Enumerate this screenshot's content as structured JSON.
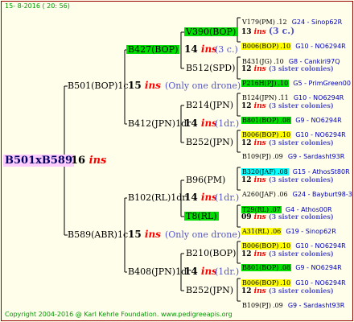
{
  "header": "15- 8-2016 ( 20: 56)",
  "footer": "Copyright 2004-2016 @ Karl Kehrle Foundation.  www.pedigreeapis.org",
  "root": {
    "label": "B501xB589",
    "gen": "16",
    "ins": "ins"
  },
  "gen2": [
    {
      "label": "B501(BOP)1c",
      "gen": "15",
      "ins": "ins",
      "note": "(Only one drone)"
    },
    {
      "label": "B589(ABR)1c",
      "gen": "15",
      "ins": "ins",
      "note": "(Only one drone)"
    }
  ],
  "gen3": [
    {
      "label": "B427(BOP)",
      "gen": "14",
      "ins": "ins",
      "note": "(3 c.)"
    },
    {
      "label": "B412(JPN)1dr",
      "gen": "14",
      "ins": "ins",
      "note": "(1dr.)"
    },
    {
      "label": "B102(RL)1dr",
      "gen": "14",
      "ins": "ins",
      "note": "(1dr.)"
    },
    {
      "label": "B408(JPN)1dr",
      "gen": "14",
      "ins": "ins",
      "note": "(1dr.)"
    }
  ],
  "gen4": [
    {
      "label": "V390(BOP)",
      "gen": "13",
      "ins": "ins",
      "note": "(3 c.)"
    },
    {
      "label": "B512(SPD)",
      "gen": "12",
      "ins": "ins",
      "note": "(3 sister colonies)"
    },
    {
      "label": "B214(JPN)",
      "gen": "12",
      "ins": "ins",
      "note": "(3 sister colonies)"
    },
    {
      "label": "B252(JPN)",
      "gen": "12",
      "ins": "ins",
      "note": "(3 sister colonies)"
    },
    {
      "label": "B96(PM)",
      "gen": "12",
      "ins": "ins",
      "note": "(3 sister colonies)"
    },
    {
      "label": "T8(RL)",
      "gen": "09",
      "ins": "ins",
      "note": "(3 sister colonies)"
    },
    {
      "label": "B210(BOP)",
      "gen": "12",
      "ins": "ins",
      "note": "(3 sister colonies)"
    },
    {
      "label": "B252(JPN)",
      "gen": "12",
      "ins": "ins",
      "note": "(3 sister colonies)"
    }
  ],
  "gen5": [
    {
      "label": "V179(PM)",
      "year": ".12",
      "code": "G24 - Sinop62R"
    },
    {
      "label": "B006(BOP)",
      "year": ".10",
      "code": "G10 - NO6294R"
    },
    {
      "label": "B431(JG)",
      "year": ".10",
      "code": "G8 - Cankiri97Q"
    },
    {
      "label": "P216H(PJ)",
      "year": ".10",
      "code": "G5 - PrimGreen00"
    },
    {
      "label": "B124(JPN)",
      "year": ".11",
      "code": "G10 - NO6294R"
    },
    {
      "label": "B801(BOP)",
      "year": ".08",
      "code": "G9 - NO6294R"
    },
    {
      "label": "B006(BOP)",
      "year": ".10",
      "code": "G10 - NO6294R"
    },
    {
      "label": "B109(PJ)",
      "year": ".09",
      "code": "G9 - Sardasht93R"
    },
    {
      "label": "B320(JAF)",
      "year": ".08",
      "code": "G15 - AthosSt80R"
    },
    {
      "label": "A260(JAF)",
      "year": ".06",
      "code": "G24 - Bayburt98-3"
    },
    {
      "label": "T29(RL)",
      "year": ".07",
      "code": "G4 - Athos00R"
    },
    {
      "label": "A31(RL)",
      "year": ".06",
      "code": "G19 - Sinop62R"
    },
    {
      "label": "B006(BOP)",
      "year": ".10",
      "code": "G10 - NO6294R"
    },
    {
      "label": "B801(BOP)",
      "year": ".08",
      "code": "G9 - NO6294R"
    },
    {
      "label": "B006(BOP)",
      "year": ".10",
      "code": "G10 - NO6294R"
    },
    {
      "label": "B109(PJ)",
      "year": ".09",
      "code": "G9 - Sardasht93R"
    }
  ]
}
